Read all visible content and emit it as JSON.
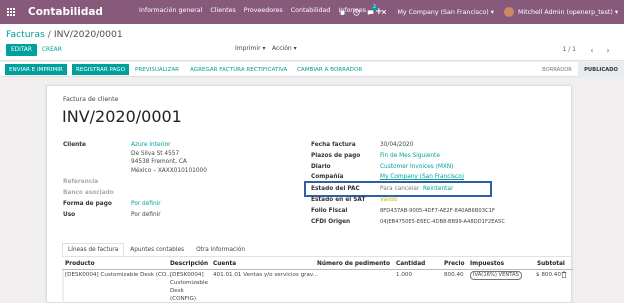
{
  "navbar": {
    "brand": "Contabilidad",
    "menu": [
      "Información general",
      "Clientes",
      "Proveedores",
      "Contabilidad",
      "Informes"
    ],
    "plus": "+",
    "chat_badge": "2",
    "company": "My Company (San Francisco)",
    "user": "Mitchell Admin (openerp_test)",
    "accent_color": "#875a7b"
  },
  "breadcrumb": {
    "parent": "Facturas",
    "separator": "/",
    "current": "INV/2020/0001"
  },
  "control": {
    "edit": "EDITAR",
    "create": "CREAR",
    "print": "Imprimir",
    "action": "Acción",
    "pager": "1 / 1",
    "prev": "‹",
    "next": "›"
  },
  "status": {
    "buttons": [
      "ENVIAR E IMPRIMIR",
      "REGISTRAR PAGO",
      "PREVISUALIZAR",
      "AGREGAR FACTURA RECTIFICATIVA",
      "CAMBIAR A BORRADOR"
    ],
    "stages": [
      "BORRADOR",
      "PUBLICADO"
    ],
    "active_stage": "PUBLICADO"
  },
  "invoice": {
    "type": "Factura de cliente",
    "name": "INV/2020/0001",
    "left": {
      "cliente_label": "Cliente",
      "cliente_name": "Azure Interior",
      "address": [
        "De Silva St 4557",
        "94538 Fremont, CA",
        "México – XAXX010101000"
      ],
      "referencia_label": "Referencia",
      "banco_label": "Banco asociado",
      "forma_pago_label": "Forma de pago",
      "forma_pago_value": "Por definir",
      "uso_label": "Uso",
      "uso_value": "Por definir"
    },
    "right": {
      "fecha_label": "Fecha factura",
      "fecha_value": "30/04/2020",
      "plazos_label": "Plazos de pago",
      "plazos_value": "Fin de Mes Siguiente",
      "diario_label": "Diario",
      "diario_value": "Customer Invoices (MXN)",
      "compania_label": "Compañía",
      "compania_value": "My Company (San Francisco)",
      "pac_label": "Estado del PAC",
      "pac_value": "Para cancelar",
      "reintentar": "Reintentar",
      "sat_label": "Estado en el SAT",
      "sat_value": "Valido",
      "folio_label": "Folio Fiscal",
      "folio_value": "8FD437AB-9005-4DF7-AE2F-840AB6B03C1F",
      "cfdi_label": "CFDI Origen",
      "cfdi_value": "04|EB4750E5-E6EC-4DB8-BB99-A48DD1F2EA5C"
    }
  },
  "tabs": [
    "Líneas de factura",
    "Apuntes contables",
    "Otra información"
  ],
  "table": {
    "headers": [
      "Producto",
      "Descripción",
      "Cuenta",
      "Número de pedimento",
      "Cantidad",
      "Precio",
      "Impuestos",
      "Subtotal"
    ],
    "row": {
      "producto": "[DESK0004] Customizable Desk (CO...",
      "descripcion": [
        "[DESK0004]",
        "Customizable",
        "Desk",
        "(CONFIG)"
      ],
      "cuenta": "401.01.01 Ventas y/o servicios grav...",
      "cantidad": "1.000",
      "precio": "800.40",
      "impuestos": "IVA(16%) VENTAS",
      "subtotal": "$ 800.40"
    }
  }
}
